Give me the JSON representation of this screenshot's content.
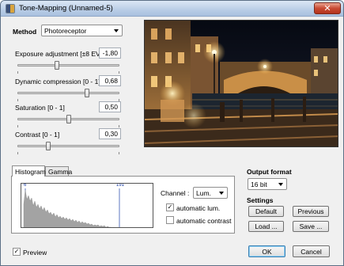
{
  "window": {
    "title": "Tone-Mapping (Unnamed-5)",
    "close_glyph": "✕"
  },
  "method": {
    "label": "Method",
    "value": "Photoreceptor"
  },
  "sliders": [
    {
      "label": "Exposure adjustment [±8 EV]",
      "value": "-1,80",
      "level": -1.8,
      "min": -8,
      "max": 8
    },
    {
      "label": "Dynamic compression [0 - 1]",
      "value": "0,68",
      "level": 0.68,
      "min": 0,
      "max": 1
    },
    {
      "label": "Saturation [0 - 1]",
      "value": "0,50",
      "level": 0.5,
      "min": 0,
      "max": 1
    },
    {
      "label": "Contrast [0 - 1]",
      "value": "0,30",
      "level": 0.3,
      "min": 0,
      "max": 1
    }
  ],
  "tabs": {
    "histogram": "Histogram",
    "gamma": "Gamma"
  },
  "histogram": {
    "min_label": "6",
    "max_label": "191"
  },
  "channel": {
    "label": "Channel :",
    "value": "Lum."
  },
  "options": {
    "auto_lum": {
      "label": "automatic lum.",
      "checked": true
    },
    "auto_contrast": {
      "label": "automatic contrast",
      "checked": false
    }
  },
  "output_format": {
    "label": "Output format",
    "value": "16 bit"
  },
  "settings": {
    "label": "Settings",
    "default": "Default",
    "previous": "Previous",
    "load": "Load ...",
    "save": "Save ..."
  },
  "preview": {
    "label": "Preview",
    "checked": true
  },
  "footer": {
    "ok": "OK",
    "cancel": "Cancel"
  },
  "check_glyph": "✓",
  "colors": {
    "title_bar": "#b9cde6",
    "close_button": "#c94b33",
    "histogram_fill": "#a3a3a3",
    "link_blue": "#1a3ea8",
    "default_button_border": "#3c7fb1"
  }
}
